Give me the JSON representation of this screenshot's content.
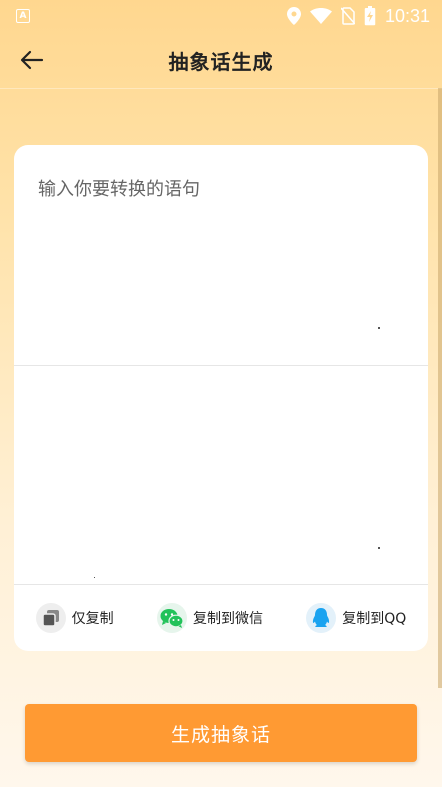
{
  "status_bar": {
    "time": "10:31",
    "app_icon_letter": "A"
  },
  "header": {
    "title": "抽象话生成",
    "back_icon": "arrow-left-icon"
  },
  "editor": {
    "input_placeholder": "输入你要转换的语句",
    "input_value": "",
    "output_value": ""
  },
  "actions": [
    {
      "label": "仅复制",
      "icon": "copy-icon"
    },
    {
      "label": "复制到微信",
      "icon": "wechat-icon"
    },
    {
      "label": "复制到QQ",
      "icon": "qq-icon"
    }
  ],
  "generate_button": {
    "label": "生成抽象话"
  },
  "colors": {
    "accent": "#FF9A33",
    "wechat": "#22C25A",
    "qq": "#1AA3F0",
    "header_bg": "#FFD78F"
  }
}
